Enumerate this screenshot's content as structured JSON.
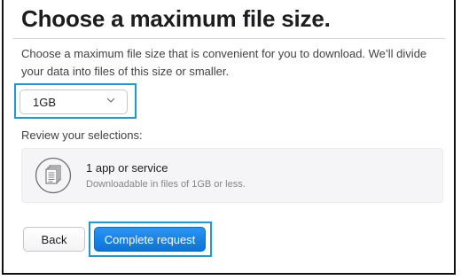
{
  "page": {
    "title": "Choose a maximum file size.",
    "description": "Choose a maximum file size that is convenient for you to download. We’ll divide your data into files of this size or smaller."
  },
  "file_size_select": {
    "value": "1GB",
    "icon": "chevron-down-icon"
  },
  "review": {
    "label": "Review your selections:",
    "card": {
      "icon": "documents-icon",
      "title": "1 app or service",
      "subtitle": "Downloadable in files of 1GB or less."
    }
  },
  "actions": {
    "back_label": "Back",
    "complete_label": "Complete request"
  },
  "colors": {
    "highlight": "#1a9ad6",
    "primary_button": "#0b74d6",
    "text": "#1d1d1f",
    "muted_text": "#86868b",
    "card_bg": "#f5f5f7"
  }
}
